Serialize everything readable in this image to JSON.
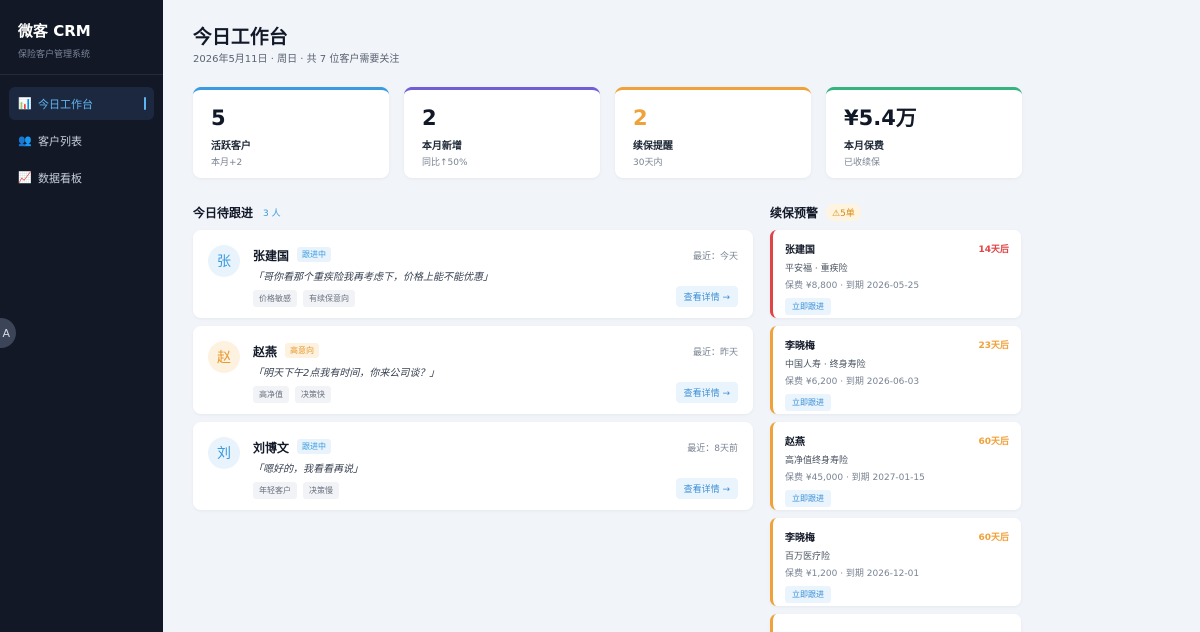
{
  "brand": {
    "title": "微客 CRM",
    "subtitle": "保险客户管理系统"
  },
  "nav": [
    {
      "icon": "📊",
      "label": "今日工作台"
    },
    {
      "icon": "👥",
      "label": "客户列表"
    },
    {
      "icon": "📈",
      "label": "数据看板"
    }
  ],
  "sidebar_toggle": "A",
  "header": {
    "title": "今日工作台",
    "subtitle": "2026年5月11日 · 周日 · 共 7 位客户需要关注"
  },
  "stats": [
    {
      "value": "5",
      "label": "活跃客户",
      "sub": "本月+2",
      "accent": "#3b9be0",
      "value_color": "#111827"
    },
    {
      "value": "2",
      "label": "本月新增",
      "sub": "同比↑50%",
      "accent": "#6f5ed6",
      "value_color": "#111827"
    },
    {
      "value": "2",
      "label": "续保提醒",
      "sub": "30天内",
      "accent": "#f0a23a",
      "value_color": "#f0a23a"
    },
    {
      "value": "¥5.4万",
      "label": "本月保费",
      "sub": "已收续保",
      "accent": "#36b37e",
      "value_color": "#111827"
    }
  ],
  "followups": {
    "title": "今日待跟进",
    "count": "3 人",
    "items": [
      {
        "avatar": "张",
        "name": "张建国",
        "status": "跟进中",
        "recent": "最近：今天",
        "quote": "「哥你看那个重疾险我再考虑下，价格上能不能优惠」",
        "tags": [
          "价格敏感",
          "有续保意向"
        ],
        "action": "查看详情 →"
      },
      {
        "avatar": "赵",
        "name": "赵燕",
        "status": "高意向",
        "recent": "最近：昨天",
        "quote": "「明天下午2点我有时间，你来公司谈？」",
        "tags": [
          "高净值",
          "决策快"
        ],
        "action": "查看详情 →"
      },
      {
        "avatar": "刘",
        "name": "刘博文",
        "status": "跟进中",
        "recent": "最近：8天前",
        "quote": "「嗯好的，我看看再说」",
        "tags": [
          "年轻客户",
          "决策慢"
        ],
        "action": "查看详情 →"
      }
    ]
  },
  "renewals": {
    "title": "续保预警",
    "badge": "⚠5单",
    "items": [
      {
        "name": "张建国",
        "days": "14天后",
        "product": "平安福 · 重疾险",
        "meta": "保费 ¥8,800 · 到期 2026-05-25",
        "action": "立即跟进",
        "color": "#e04444"
      },
      {
        "name": "李晓梅",
        "days": "23天后",
        "product": "中国人寿 · 终身寿险",
        "meta": "保费 ¥6,200 · 到期 2026-06-03",
        "action": "立即跟进",
        "color": "#f0a23a"
      },
      {
        "name": "赵燕",
        "days": "60天后",
        "product": "高净值终身寿险",
        "meta": "保费 ¥45,000 · 到期 2027-01-15",
        "action": "立即跟进",
        "color": "#f0a23a"
      },
      {
        "name": "李晓梅",
        "days": "60天后",
        "product": "百万医疗险",
        "meta": "保费 ¥1,200 · 到期 2026-12-01",
        "action": "立即跟进",
        "color": "#f0a23a"
      }
    ]
  }
}
